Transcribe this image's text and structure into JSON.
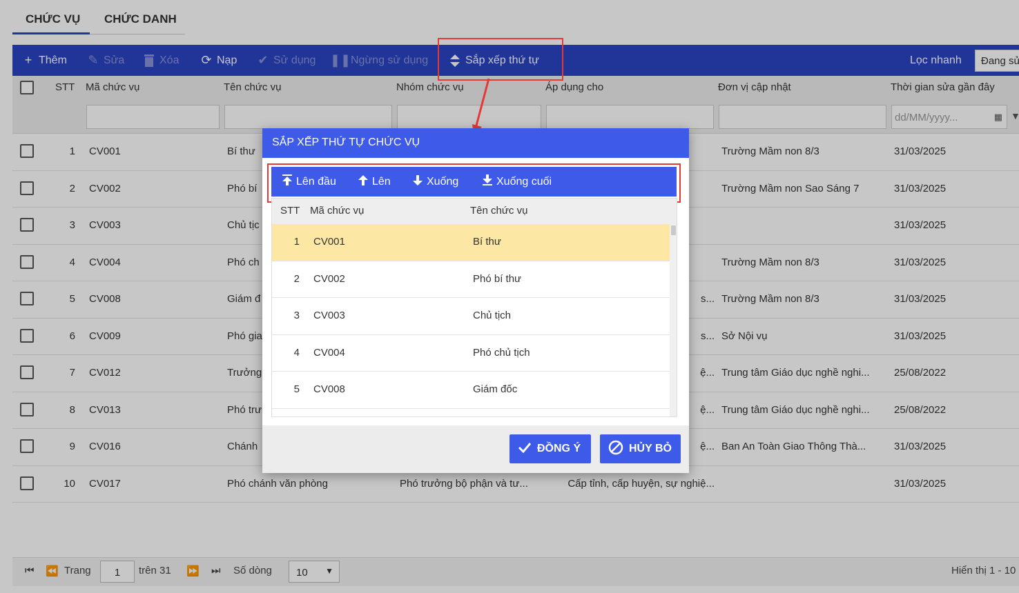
{
  "tabs": [
    {
      "label": "CHỨC VỤ",
      "active": true
    },
    {
      "label": "CHỨC DANH",
      "active": false
    }
  ],
  "toolbar": {
    "add": "Thêm",
    "edit": "Sửa",
    "delete": "Xóa",
    "reload": "Nạp",
    "use": "Sử dụng",
    "stop_use": "Ngừng sử dụng",
    "sort_order": "Sắp xếp thứ tự",
    "quick_filter_label": "Lọc nhanh",
    "quick_filter_value": "Đang sử"
  },
  "grid": {
    "columns": {
      "stt": "STT",
      "code": "Mã chức vụ",
      "name": "Tên chức vụ",
      "group": "Nhóm chức vụ",
      "apply": "Áp dụng cho",
      "unit": "Đơn vị cập nhật",
      "updated": "Thời gian sửa gần đây"
    },
    "date_placeholder": "dd/MM/yyyy...",
    "rows": [
      {
        "stt": "1",
        "code": "CV001",
        "name": "Bí thư",
        "group": "",
        "apply": "",
        "unit": "Trường Mầm non 8/3",
        "updated": "31/03/2025"
      },
      {
        "stt": "2",
        "code": "CV002",
        "name": "Phó bí",
        "group": "",
        "apply": "",
        "unit": "Trường Mầm non Sao Sáng 7",
        "updated": "31/03/2025"
      },
      {
        "stt": "3",
        "code": "CV003",
        "name": "Chủ tịc",
        "group": "",
        "apply": "",
        "unit": "",
        "updated": "31/03/2025"
      },
      {
        "stt": "4",
        "code": "CV004",
        "name": "Phó ch",
        "group": "",
        "apply": "",
        "unit": "Trường Mầm non 8/3",
        "updated": "31/03/2025"
      },
      {
        "stt": "5",
        "code": "CV008",
        "name": "Giám đ",
        "group": "",
        "apply": "s...",
        "unit": "Trường Mầm non 8/3",
        "updated": "31/03/2025"
      },
      {
        "stt": "6",
        "code": "CV009",
        "name": "Phó gia",
        "group": "",
        "apply": "s...",
        "unit": "Sở Nội vụ",
        "updated": "31/03/2025"
      },
      {
        "stt": "7",
        "code": "CV012",
        "name": "Trưởng",
        "group": "",
        "apply": "ệ...",
        "unit": "Trung tâm Giáo dục nghề nghi...",
        "updated": "25/08/2022"
      },
      {
        "stt": "8",
        "code": "CV013",
        "name": "Phó trư",
        "group": "",
        "apply": "ệ...",
        "unit": "Trung tâm Giáo dục nghề nghi...",
        "updated": "25/08/2022"
      },
      {
        "stt": "9",
        "code": "CV016",
        "name": "Chánh",
        "group": "",
        "apply": "ệ...",
        "unit": "Ban An Toàn Giao Thông Thà...",
        "updated": "31/03/2025"
      },
      {
        "stt": "10",
        "code": "CV017",
        "name": "Phó chánh văn phòng",
        "group": "Phó trưởng bộ phận và tư...",
        "apply": "Cấp tỉnh, cấp huyện, sự nghiệ...",
        "unit": "",
        "updated": "31/03/2025"
      }
    ]
  },
  "pager": {
    "page_label": "Trang",
    "page_value": "1",
    "of_label": "trên 31",
    "rows_label": "Số dòng",
    "rows_value": "10",
    "display": "Hiển thị 1 - 10"
  },
  "dialog": {
    "title": "SẮP XẾP THỨ TỰ CHỨC VỤ",
    "tools": {
      "to_top": "Lên đầu",
      "up": "Lên",
      "down": "Xuống",
      "to_bottom": "Xuống cuối"
    },
    "columns": {
      "stt": "STT",
      "code": "Mã chức vụ",
      "name": "Tên chức vụ"
    },
    "rows": [
      {
        "stt": "1",
        "code": "CV001",
        "name": "Bí thư",
        "selected": true
      },
      {
        "stt": "2",
        "code": "CV002",
        "name": "Phó bí thư",
        "selected": false
      },
      {
        "stt": "3",
        "code": "CV003",
        "name": "Chủ tịch",
        "selected": false
      },
      {
        "stt": "4",
        "code": "CV004",
        "name": "Phó chủ tịch",
        "selected": false
      },
      {
        "stt": "5",
        "code": "CV008",
        "name": "Giám đốc",
        "selected": false
      }
    ],
    "ok": "ĐỒNG Ý",
    "cancel": "HỦY BỎ"
  },
  "colors": {
    "toolbar": "#2b44c4",
    "dialog_accent": "#3d5ae8",
    "selected_row": "#fde7a4",
    "annotation": "#e53935"
  }
}
